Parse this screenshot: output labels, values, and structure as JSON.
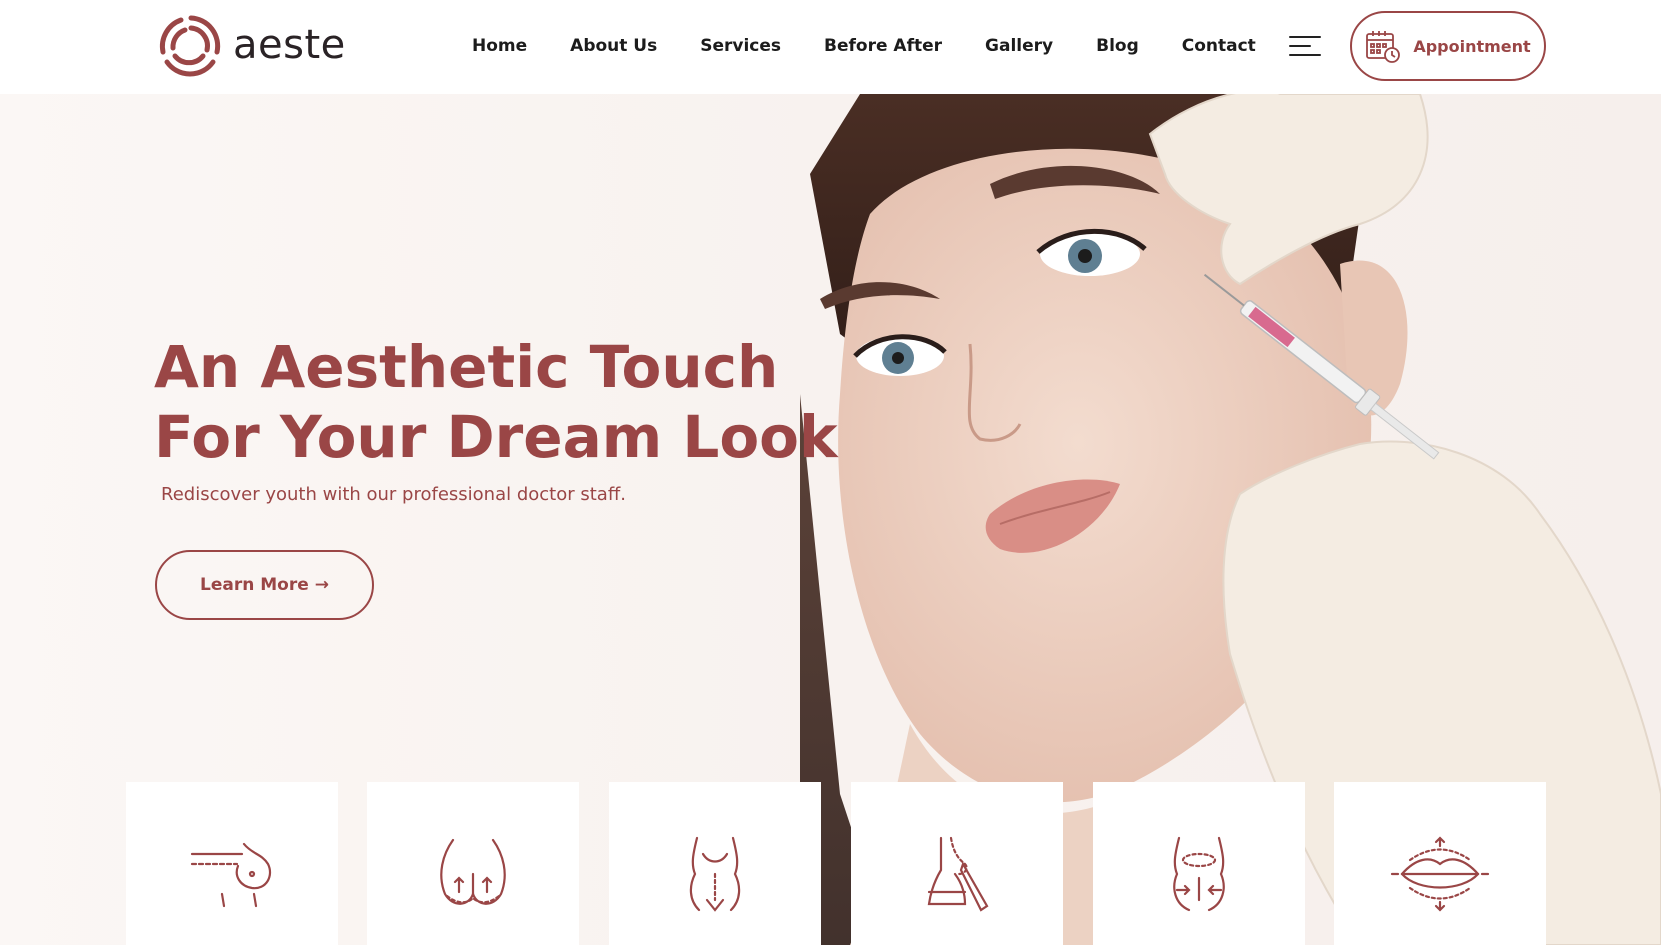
{
  "brand": {
    "name": "aeste",
    "color": "#9a4646"
  },
  "nav": {
    "items": [
      {
        "label": "Home"
      },
      {
        "label": "About Us"
      },
      {
        "label": "Services"
      },
      {
        "label": "Before After"
      },
      {
        "label": "Gallery"
      },
      {
        "label": "Blog"
      },
      {
        "label": "Contact"
      }
    ],
    "menu_icon": "hamburger-menu-icon",
    "appointment_label": "Appointment",
    "appointment_icon": "calendar-clock-icon"
  },
  "hero": {
    "headline_line1": "An Aesthetic Touch",
    "headline_line2": "For Your Dream Look",
    "subline": "Rediscover youth with our professional doctor staff.",
    "cta_label": "Learn More →"
  },
  "services": {
    "icons": [
      "breast-surgery-icon",
      "buttock-lift-icon",
      "body-contouring-icon",
      "rhinoplasty-icon",
      "liposuction-icon",
      "lip-augmentation-icon"
    ]
  }
}
